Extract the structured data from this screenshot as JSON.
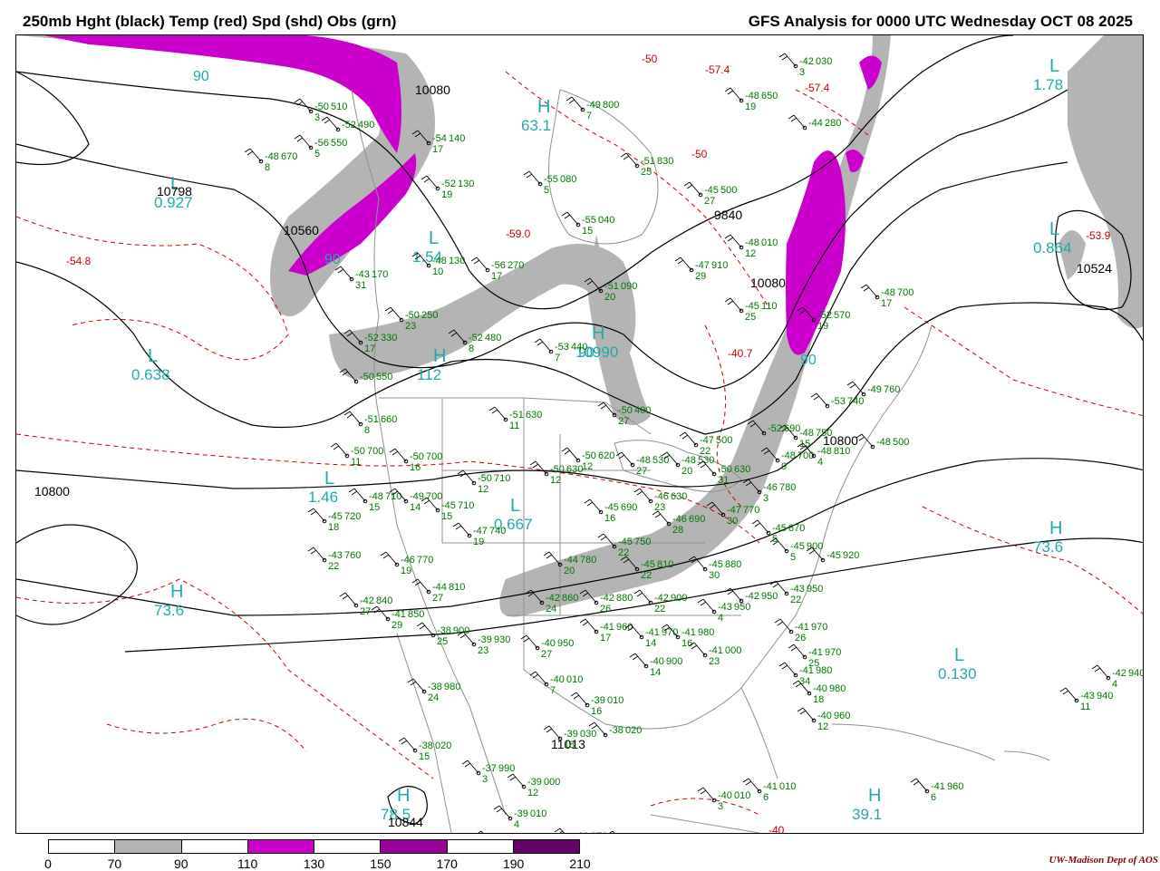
{
  "header": {
    "left_title": "250mb Hght (black) Temp (red) Spd (shd) Obs (grn)",
    "right_title": "GFS Analysis for 0000 UTC Wednesday  OCT 08 2025"
  },
  "credit": "UW-Madison  Dept of AOS",
  "colorbar": {
    "labels": [
      "0",
      "70",
      "90",
      "110",
      "130",
      "150",
      "170",
      "190",
      "210"
    ],
    "colors": [
      "#ffffff",
      "#b4b4b4",
      "#ffffff",
      "#cc00cc",
      "#ffffff",
      "#990099",
      "#ffffff",
      "#660066"
    ]
  },
  "colors": {
    "height": "#000000",
    "temp": "#cc0000",
    "wind_fast": "#b4b4b4",
    "wind_jet": "#cc00cc",
    "obs": "#007700",
    "geography": "#909090",
    "pressure_centers": "#22aaaa"
  },
  "centers": [
    {
      "letter": "L",
      "value": "1.78"
    },
    {
      "letter": "L",
      "value": "0.927"
    },
    {
      "letter": "L",
      "value": "1.54"
    },
    {
      "letter": "H",
      "value": "63.1"
    },
    {
      "letter": "L",
      "value": "0.864"
    },
    {
      "letter": "L",
      "value": "0.638"
    },
    {
      "letter": "L",
      "value": "1.46"
    },
    {
      "letter": "L",
      "value": "0.667"
    },
    {
      "letter": "H",
      "value": "10990"
    },
    {
      "letter": "H",
      "value": "73.6"
    },
    {
      "letter": "H",
      "value": "73.6"
    },
    {
      "letter": "L",
      "value": "0.130"
    },
    {
      "letter": "H",
      "value": "39.1"
    },
    {
      "letter": "H",
      "value": "78.5"
    },
    {
      "letter": "H",
      "value": "112"
    }
  ],
  "height_labels": [
    "10080",
    "10798",
    "10560",
    "9840",
    "10080",
    "10524",
    "10800",
    "10800",
    "11013",
    "10844"
  ],
  "temp_labels": [
    "-57.4",
    "-50",
    "-54.8",
    "-59.0",
    "-50",
    "-53.9",
    "-40.7",
    "-40",
    "-57.4"
  ],
  "speed_labels": [
    "90",
    "90",
    "90",
    "90"
  ],
  "observations": [
    {
      "t": "-50",
      "h": "510",
      "d": "3"
    },
    {
      "t": "-52",
      "h": "490",
      "d": ""
    },
    {
      "t": "-56",
      "h": "550",
      "d": "5"
    },
    {
      "t": "-48",
      "h": "670",
      "d": "8"
    },
    {
      "t": "-54",
      "h": "140",
      "d": "17"
    },
    {
      "t": "-52",
      "h": "130",
      "d": "19"
    },
    {
      "t": "-48",
      "h": "130",
      "d": "10"
    },
    {
      "t": "-56",
      "h": "270",
      "d": "17"
    },
    {
      "t": "-43",
      "h": "170",
      "d": "31"
    },
    {
      "t": "-50",
      "h": "250",
      "d": "23"
    },
    {
      "t": "-52",
      "h": "330",
      "d": "17"
    },
    {
      "t": "-52",
      "h": "480",
      "d": "8"
    },
    {
      "t": "-50",
      "h": "550",
      "d": ""
    },
    {
      "t": "-55",
      "h": "040",
      "d": "15"
    },
    {
      "t": "-51",
      "h": "090",
      "d": "20"
    },
    {
      "t": "-53",
      "h": "440",
      "d": "7"
    },
    {
      "t": "-47",
      "h": "910",
      "d": "29"
    },
    {
      "t": "-48",
      "h": "010",
      "d": "12"
    },
    {
      "t": "-45",
      "h": "110",
      "d": "25"
    },
    {
      "t": "-52",
      "h": "570",
      "d": "19"
    },
    {
      "t": "-48",
      "h": "700",
      "d": "17"
    },
    {
      "t": "-51",
      "h": "660",
      "d": "8"
    },
    {
      "t": "-51",
      "h": "630",
      "d": "11"
    },
    {
      "t": "-50",
      "h": "700",
      "d": "11"
    },
    {
      "t": "-50",
      "h": "700",
      "d": "16"
    },
    {
      "t": "-50",
      "h": "710",
      "d": "12"
    },
    {
      "t": "-50",
      "h": "620",
      "d": "12"
    },
    {
      "t": "-50",
      "h": "630",
      "d": "12"
    },
    {
      "t": "-48",
      "h": "530",
      "d": "27"
    },
    {
      "t": "-48",
      "h": "530",
      "d": "20"
    },
    {
      "t": "-47",
      "h": "500",
      "d": "22"
    },
    {
      "t": "-50",
      "h": "630",
      "d": "31"
    },
    {
      "t": "-50",
      "h": "400",
      "d": "27"
    },
    {
      "t": "-48",
      "h": "710",
      "d": "15"
    },
    {
      "t": "-49",
      "h": "700",
      "d": "14"
    },
    {
      "t": "-45",
      "h": "710",
      "d": "15"
    },
    {
      "t": "-47",
      "h": "740",
      "d": "19"
    },
    {
      "t": "-45",
      "h": "720",
      "d": "18"
    },
    {
      "t": "-46",
      "h": "630",
      "d": "23"
    },
    {
      "t": "-45",
      "h": "690",
      "d": "16"
    },
    {
      "t": "-46",
      "h": "690",
      "d": "28"
    },
    {
      "t": "-47",
      "h": "770",
      "d": "30"
    },
    {
      "t": "-46",
      "h": "780",
      "d": "3"
    },
    {
      "t": "-48",
      "h": "700",
      "d": "9"
    },
    {
      "t": "-48",
      "h": "750",
      "d": "15"
    },
    {
      "t": "-48",
      "h": "810",
      "d": "4"
    },
    {
      "t": "-45",
      "h": "870",
      "d": "5"
    },
    {
      "t": "-45",
      "h": "900",
      "d": "5"
    },
    {
      "t": "-45",
      "h": "920",
      "d": ""
    },
    {
      "t": "-43",
      "h": "760",
      "d": "22"
    },
    {
      "t": "-46",
      "h": "770",
      "d": "19"
    },
    {
      "t": "-44",
      "h": "780",
      "d": "20"
    },
    {
      "t": "-45",
      "h": "750",
      "d": "22"
    },
    {
      "t": "-45",
      "h": "810",
      "d": "22"
    },
    {
      "t": "-45",
      "h": "880",
      "d": "30"
    },
    {
      "t": "-42",
      "h": "840",
      "d": "27"
    },
    {
      "t": "-41",
      "h": "850",
      "d": "29"
    },
    {
      "t": "-44",
      "h": "810",
      "d": "27"
    },
    {
      "t": "-42",
      "h": "860",
      "d": "24"
    },
    {
      "t": "-42",
      "h": "880",
      "d": "26"
    },
    {
      "t": "-42",
      "h": "900",
      "d": "22"
    },
    {
      "t": "-43",
      "h": "950",
      "d": "4"
    },
    {
      "t": "-42",
      "h": "950",
      "d": ""
    },
    {
      "t": "-43",
      "h": "950",
      "d": "22"
    },
    {
      "t": "-41",
      "h": "970",
      "d": "26"
    },
    {
      "t": "-38",
      "h": "900",
      "d": "25"
    },
    {
      "t": "-39",
      "h": "930",
      "d": "23"
    },
    {
      "t": "-40",
      "h": "950",
      "d": "27"
    },
    {
      "t": "-41",
      "h": "960",
      "d": "17"
    },
    {
      "t": "-41",
      "h": "970",
      "d": "14"
    },
    {
      "t": "-41",
      "h": "980",
      "d": "16"
    },
    {
      "t": "-41",
      "h": "000",
      "d": "23"
    },
    {
      "t": "-40",
      "h": "900",
      "d": "14"
    },
    {
      "t": "-41",
      "h": "970",
      "d": "25"
    },
    {
      "t": "-41",
      "h": "980",
      "d": "34"
    },
    {
      "t": "-40",
      "h": "980",
      "d": "18"
    },
    {
      "t": "-40",
      "h": "960",
      "d": "12"
    },
    {
      "t": "-38",
      "h": "980",
      "d": "24"
    },
    {
      "t": "-40",
      "h": "010",
      "d": "7"
    },
    {
      "t": "-39",
      "h": "010",
      "d": "16"
    },
    {
      "t": "-39",
      "h": "030",
      "d": "18"
    },
    {
      "t": "-38",
      "h": "020",
      "d": ""
    },
    {
      "t": "-38",
      "h": "020",
      "d": "15"
    },
    {
      "t": "-37",
      "h": "990",
      "d": "3"
    },
    {
      "t": "-39",
      "h": "000",
      "d": "12"
    },
    {
      "t": "-39",
      "h": "010",
      "d": "4"
    },
    {
      "t": "-39",
      "h": "010",
      "d": ""
    },
    {
      "t": "-39",
      "h": "970",
      "d": ""
    },
    {
      "t": "-40",
      "h": "990",
      "d": ""
    },
    {
      "t": "-40",
      "h": "010",
      "d": "3"
    },
    {
      "t": "-41",
      "h": "010",
      "d": "6"
    },
    {
      "t": "-41",
      "h": "960",
      "d": "6"
    },
    {
      "t": "-43",
      "h": "940",
      "d": "11"
    },
    {
      "t": "-42",
      "h": "940",
      "d": "4"
    },
    {
      "t": "-48",
      "h": "650",
      "d": "19"
    },
    {
      "t": "-45",
      "h": "500",
      "d": "27"
    },
    {
      "t": "-51",
      "h": "830",
      "d": "25"
    },
    {
      "t": "-55",
      "h": "080",
      "d": "5"
    },
    {
      "t": "-49",
      "h": "800",
      "d": "7"
    },
    {
      "t": "-44",
      "h": "280",
      "d": ""
    },
    {
      "t": "-42",
      "h": "030",
      "d": "3"
    },
    {
      "t": "-52",
      "h": "690",
      "d": ""
    },
    {
      "t": "-49",
      "h": "760",
      "d": ""
    },
    {
      "t": "-53",
      "h": "740",
      "d": ""
    },
    {
      "t": "-48",
      "h": "500",
      "d": ""
    }
  ]
}
